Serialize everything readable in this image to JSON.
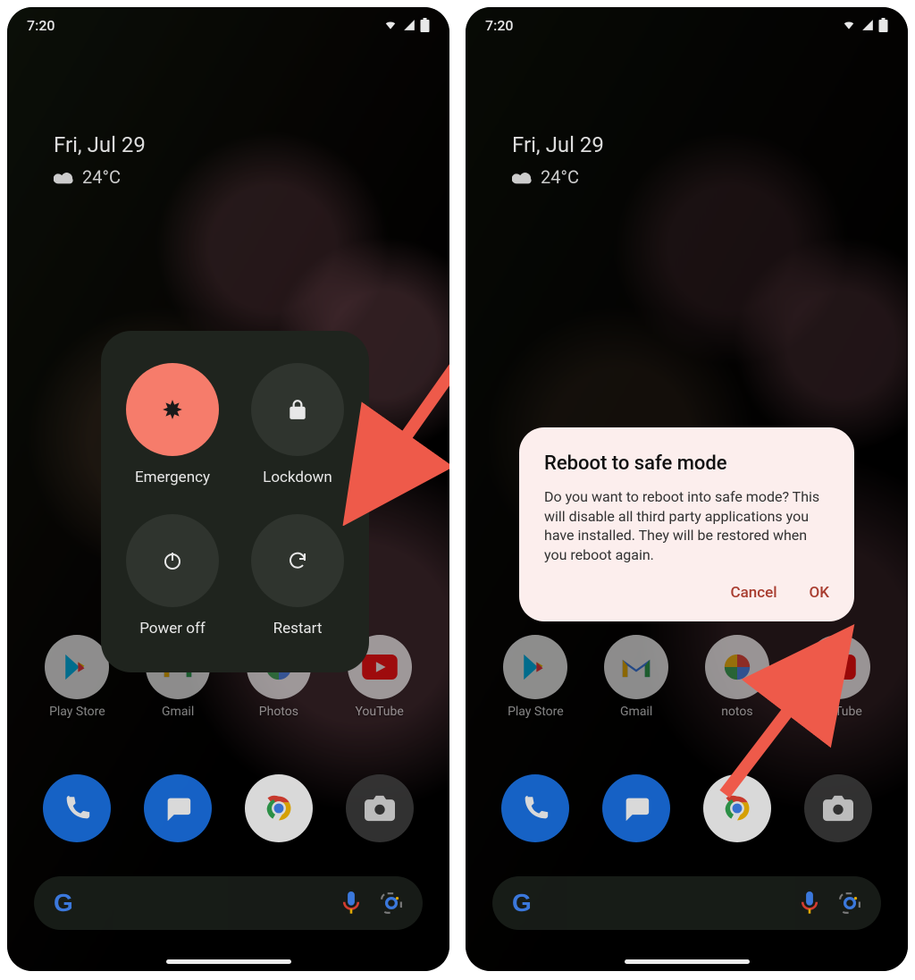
{
  "status": {
    "time": "7:20"
  },
  "home": {
    "date": "Fri, Jul 29",
    "temp": "24°C"
  },
  "power_menu": {
    "emergency": "Emergency",
    "lockdown": "Lockdown",
    "poweroff": "Power off",
    "restart": "Restart"
  },
  "dialog": {
    "title": "Reboot to safe mode",
    "body": "Do you want to reboot into safe mode? This will disable all third party applications you have installed. They will be restored when you reboot again.",
    "cancel": "Cancel",
    "ok": "OK"
  },
  "apps": {
    "playstore": "Play Store",
    "gmail": "Gmail",
    "photos": "Photos",
    "youtube": "YouTube",
    "photos_cropped": "notos"
  },
  "colors": {
    "emergency_bg": "#f67c6b",
    "panel_bg": "#1f241e",
    "dialog_bg": "#fceeed",
    "dialog_action": "#a83c2f",
    "annotation_arrow": "#ee5a4a"
  }
}
